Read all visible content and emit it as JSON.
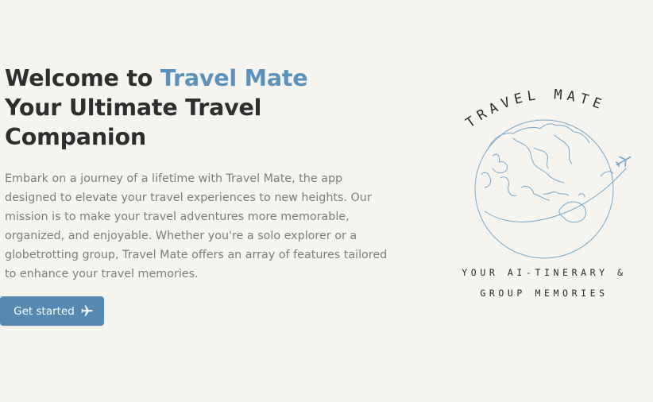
{
  "hero": {
    "heading_prefix": "Welcome to ",
    "heading_brand": "Travel Mate",
    "heading_line2": "Your Ultimate Travel",
    "heading_line3": "Companion",
    "description": "Embark on a journey of a lifetime with Travel Mate, the app designed to elevate your travel experiences to new heights. Our mission is to make your travel adventures more memorable, organized, and enjoyable. Whether you're a solo explorer or a globetrotting group, Travel Mate offers an array of features tailored to enhance your travel memories.",
    "cta_label": "Get started",
    "cta_icon": "airplane-icon"
  },
  "logo": {
    "arc_text": "TRAVEL MATE",
    "tagline_line1": "YOUR AI-TINERARY &",
    "tagline_line2": "GROUP MEMORIES",
    "graphic": "globe-with-airplane-icon"
  },
  "colors": {
    "background": "#f5f4ef",
    "accent": "#5b92bc",
    "button": "#5589b1",
    "heading": "#2e2e2e",
    "body_text": "#7d7d7d",
    "logo_line": "#7aa7c7"
  }
}
